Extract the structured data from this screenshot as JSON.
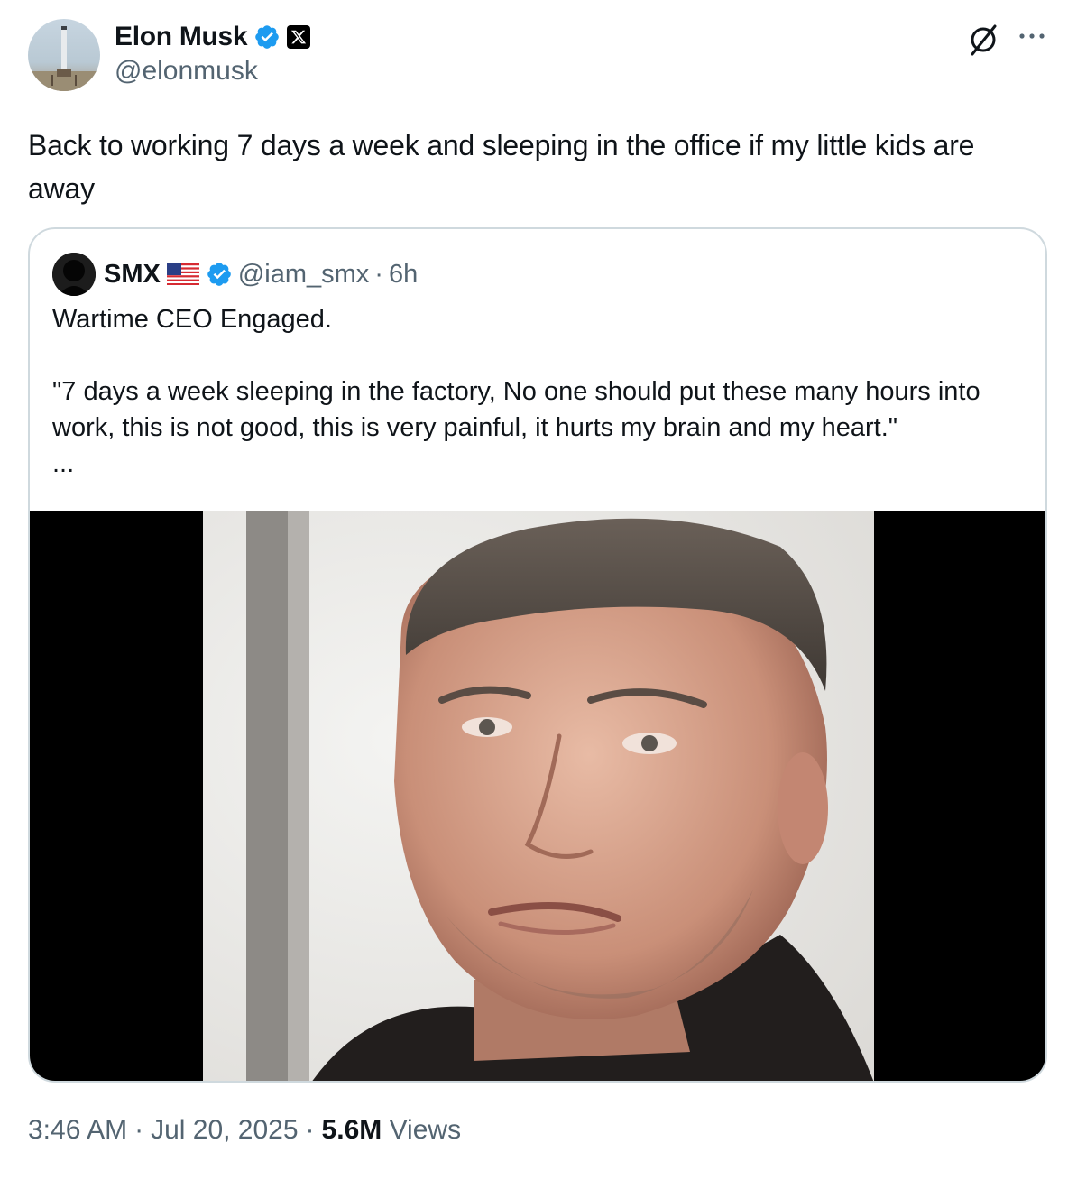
{
  "tweet": {
    "author": {
      "display_name": "Elon Musk",
      "handle": "@elonmusk",
      "verified": true,
      "affiliation_icon": "x-logo-icon"
    },
    "text": "Back to working 7 days a week and sleeping in the office if my little kids are away",
    "header_actions": {
      "grok_icon": "grok-icon",
      "more_icon": "more-icon"
    },
    "quote": {
      "author": {
        "display_name": "SMX",
        "flag": "us-flag-icon",
        "verified": true,
        "handle": "@iam_smx",
        "separator": "·",
        "time": "6h"
      },
      "text": "Wartime CEO Engaged.\n\n\"7 days a week sleeping in the factory, No one should put these many hours into work, this is not good, this is very painful, it hurts my brain and my heart.\"\n...",
      "media": "video-thumbnail"
    },
    "footer": {
      "time": "3:46 AM",
      "sep1": "·",
      "date": "Jul 20, 2025",
      "sep2": "·",
      "views_count": "5.6M",
      "views_label": "Views"
    }
  },
  "colors": {
    "text": "#0f1419",
    "secondary": "#536471",
    "verified": "#1d9bf0",
    "border": "#cfd9de"
  }
}
